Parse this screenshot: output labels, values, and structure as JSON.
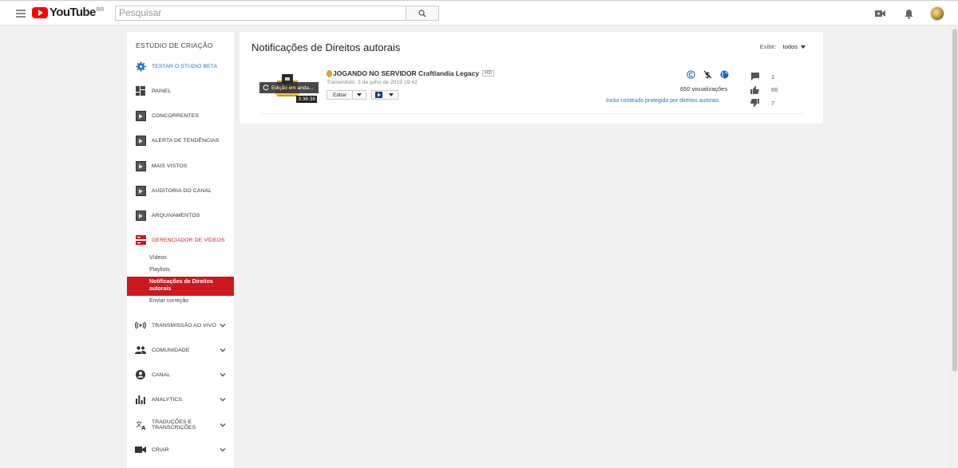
{
  "header": {
    "logo_text": "YouTube",
    "logo_region": "BR",
    "search_placeholder": "Pesquisar"
  },
  "sidebar": {
    "title": "ESTÚDIO DE CRIAÇÃO",
    "items": [
      {
        "label": "TESTAR O STUDIO BETA",
        "icon": "gear-icon",
        "color": "#167ac6"
      },
      {
        "label": "PAINEL",
        "icon": "dashboard-icon"
      },
      {
        "label": "CONCORRENTES",
        "icon": "extension-tile-icon"
      },
      {
        "label": "ALERTA DE TENDÊNCIAS",
        "icon": "extension-tile-icon"
      },
      {
        "label": "MAIS VISTOS",
        "icon": "extension-tile-icon"
      },
      {
        "label": "AUDITORIA DO CANAL",
        "icon": "extension-tile-icon"
      },
      {
        "label": "ARQUIVAMENTOS",
        "icon": "extension-tile-icon"
      },
      {
        "label": "GERENCIADOR DE VÍDEOS",
        "icon": "video-manager-icon",
        "color": "#cc181e"
      },
      {
        "label": "TRANSMISSÃO AO VIVO",
        "icon": "live-icon"
      },
      {
        "label": "COMUNIDADE",
        "icon": "community-icon"
      },
      {
        "label": "CANAL",
        "icon": "channel-icon"
      },
      {
        "label": "ANALYTICS",
        "icon": "analytics-icon"
      },
      {
        "label": "TRADUÇÕES E TRANSCRIÇÕES",
        "icon": "translate-icon"
      },
      {
        "label": "CRIAR",
        "icon": "camera-icon"
      }
    ],
    "subitems": [
      {
        "label": "Vídeos"
      },
      {
        "label": "Playlists"
      },
      {
        "label": "Notificações de Direitos autorais"
      },
      {
        "label": "Enviar correção"
      }
    ]
  },
  "main": {
    "title": "Notificações de Direitos autorais",
    "filter_label": "Exibir:",
    "filter_value": "todos",
    "video": {
      "title": "JOGANDO NO SERVIDOR Craftlandia Legacy",
      "hd": "HD",
      "date": "Transmitido: 3 de julho de 2019 19:42",
      "overlay_text": "Edição em anda...",
      "duration": "3:36:38",
      "edit_label": "Editar",
      "views": "650 visualizações",
      "claim_link": "Inclui conteúdo protegido por direitos autorais",
      "comments": "1",
      "likes": "66",
      "dislikes": "7"
    }
  },
  "colors": {
    "accent": "#cc181e",
    "link": "#167ac6",
    "copyright_blue": "#1c62b9"
  }
}
